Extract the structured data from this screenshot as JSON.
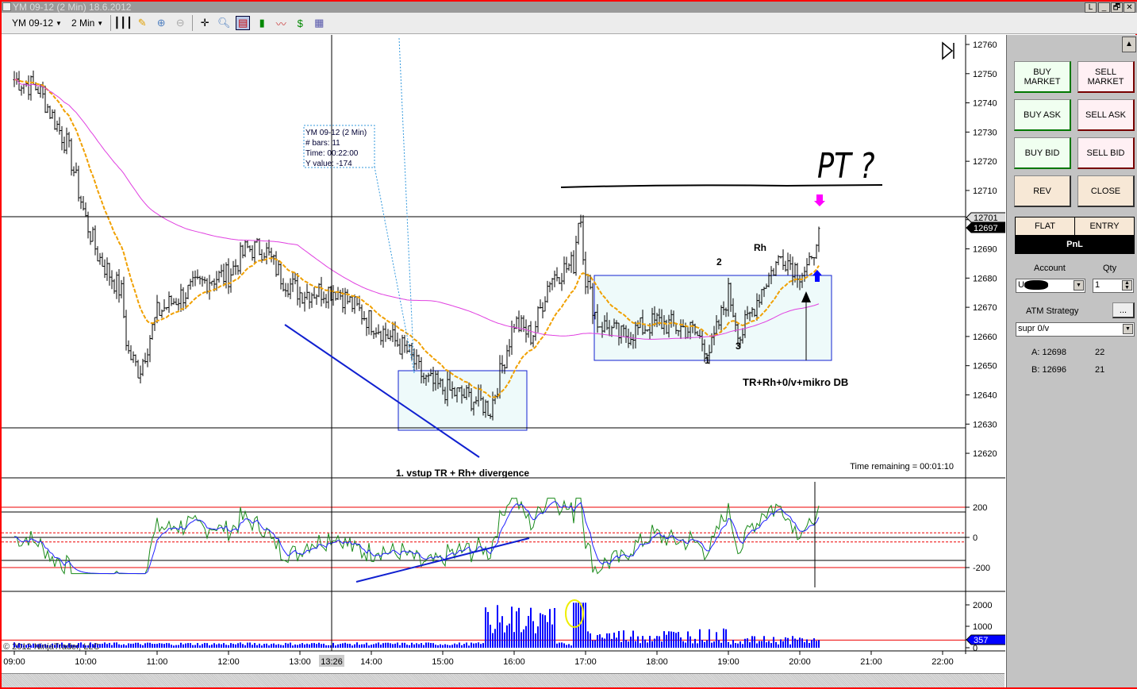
{
  "window": {
    "title": "YM 09-12 (2 Min)  18.6.2012",
    "buttons": [
      "L",
      "_",
      "🗗",
      "✕"
    ]
  },
  "toolbar": {
    "instrument": "YM 09-12",
    "interval": "2 Min",
    "icons": [
      "bar-type-icon",
      "pencil-icon",
      "zoom-in-icon",
      "zoom-out-icon",
      "crosshair-icon",
      "magnifier-icon",
      "chart-trader-icon",
      "candles-icon",
      "indicators-icon",
      "strategy-icon",
      "properties-icon"
    ]
  },
  "colors": {
    "ema": "#f0a000",
    "sma": "#e040e0",
    "price": "#000000",
    "osc1": "#1a8a1a",
    "osc2": "#2020ff",
    "volume": "#0000ff",
    "drawing": "#1020d0",
    "box_fill": "#eefafa"
  },
  "chart_data": {
    "type": "ohlc",
    "title": "YM 09-12 (2 Min)",
    "ylim": [
      12615,
      12763
    ],
    "y_ticks": [
      12760,
      12750,
      12740,
      12730,
      12720,
      12710,
      12700,
      12690,
      12680,
      12670,
      12660,
      12650,
      12640,
      12630,
      12620
    ],
    "x_ticks": [
      "09:00",
      "10:00",
      "11:00",
      "12:00",
      "13:00",
      "14:00",
      "15:00",
      "16:00",
      "17:00",
      "18:00",
      "19:00",
      "20:00",
      "21:00",
      "22:00"
    ],
    "price_path_minutes": [
      0,
      20,
      45,
      60,
      70,
      90,
      95,
      105,
      120,
      140,
      165,
      180,
      195,
      210,
      225,
      240,
      270,
      300,
      330,
      345,
      360,
      390,
      400,
      420,
      435,
      450,
      470,
      475,
      480,
      490,
      510,
      540,
      570,
      585,
      600,
      610,
      630,
      645,
      660,
      670,
      675
    ],
    "price_path_values": [
      12748,
      12745,
      12725,
      12700,
      12688,
      12675,
      12655,
      12648,
      12668,
      12674,
      12680,
      12681,
      12690,
      12690,
      12680,
      12675,
      12676,
      12665,
      12655,
      12645,
      12642,
      12638,
      12635,
      12665,
      12660,
      12680,
      12685,
      12705,
      12680,
      12665,
      12660,
      12665,
      12662,
      12655,
      12675,
      12660,
      12678,
      12688,
      12682,
      12684,
      12698
    ],
    "last_price": "12697",
    "crosshair_price": "12701",
    "crosshair_time": "13:26",
    "osc_ticks": [
      "200",
      "0",
      "-200"
    ],
    "vol_ticks": [
      "2000",
      "1000",
      "0"
    ],
    "last_volume": "357"
  },
  "info_box": {
    "line1": "YM 09-12 (2 Min)",
    "line2": "# bars:     11",
    "line3": "Time:       00:22:00",
    "line4": "Y value: -174"
  },
  "annotations": {
    "entry1": "1. vstup TR + Rh+ divergence",
    "setup": "TR+Rh+0/v+mikro DB",
    "n2": "2",
    "rh": "Rh",
    "n3": "3",
    "n1": "1",
    "pt": "PT ?",
    "time_remaining": "Time remaining = 00:01:10",
    "copyright": "© 2012 NinjaTrader, LLC"
  },
  "side": {
    "buy_market": "BUY MARKET",
    "sell_market": "SELL MARKET",
    "buy_ask": "BUY ASK",
    "sell_ask": "SELL ASK",
    "buy_bid": "BUY BID",
    "sell_bid": "SELL BID",
    "rev": "REV",
    "close": "CLOSE",
    "flat": "FLAT",
    "entry": "ENTRY",
    "pnl": "PnL",
    "account_label": "Account",
    "qty_label": "Qty",
    "account_value": "U",
    "qty_value": "1",
    "atm_label": "ATM Strategy",
    "atm_btn": "...",
    "atm_value": "supr 0/v",
    "ask": "A: 12698",
    "ask_size": "22",
    "bid": "B: 12696",
    "bid_size": "21"
  }
}
